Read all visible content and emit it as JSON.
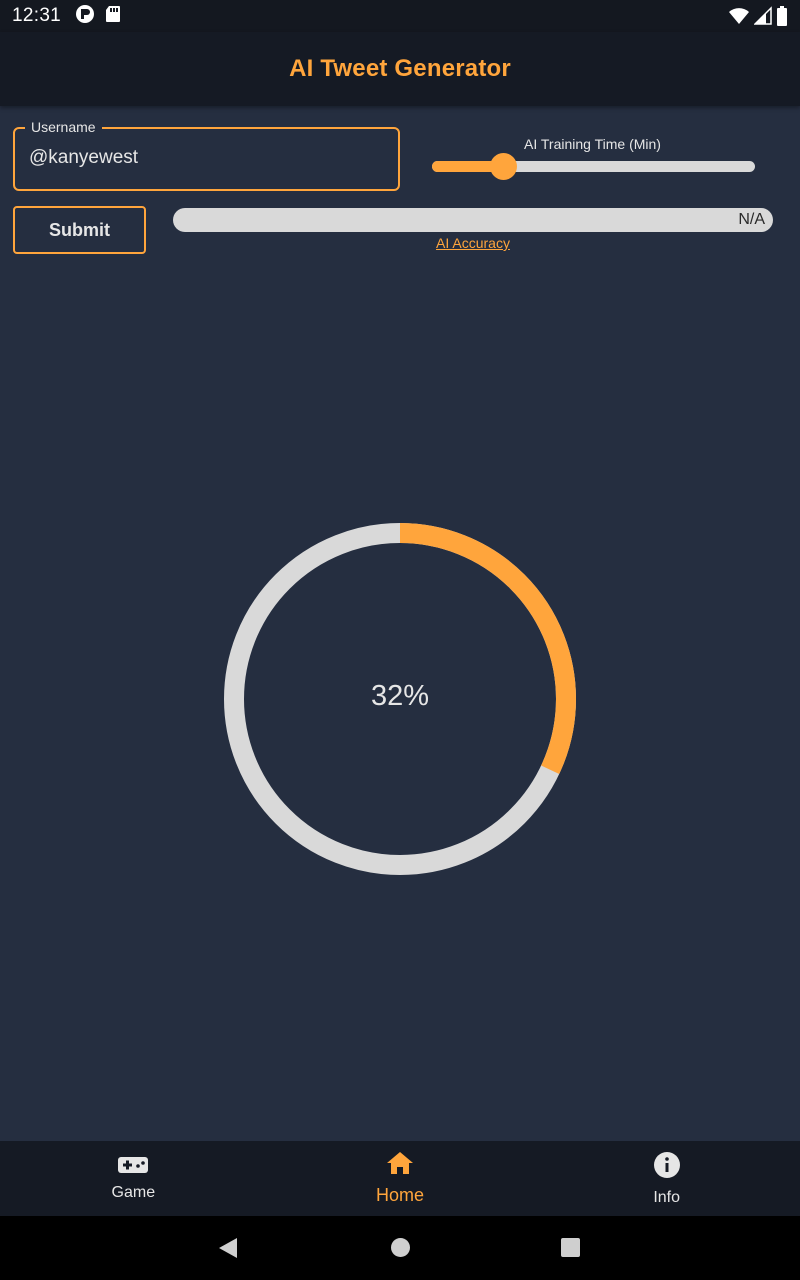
{
  "status_bar": {
    "time": "12:31",
    "left_icons": [
      "media-app-icon",
      "sd-card-icon"
    ],
    "right_icons": [
      "wifi-icon",
      "cell-signal-icon",
      "battery-icon"
    ]
  },
  "app_bar": {
    "title": "AI Tweet Generator"
  },
  "form": {
    "username_label": "Username",
    "username_value": "@kanyewest",
    "slider_label": "AI Training Time (Min)",
    "slider_fraction": 0.22,
    "submit_label": "Submit",
    "accuracy_value": "N/A",
    "accuracy_link": "AI Accuracy"
  },
  "progress": {
    "percent": 32,
    "label": "32%"
  },
  "bottom_nav": {
    "items": [
      {
        "label": "Game",
        "icon": "gamepad-icon",
        "active": false
      },
      {
        "label": "Home",
        "icon": "home-icon",
        "active": true
      },
      {
        "label": "Info",
        "icon": "info-icon",
        "active": false
      }
    ]
  },
  "colors": {
    "accent": "#ffa53c",
    "background": "#252e40",
    "bar": "#151a24",
    "track": "#d9d9d9",
    "text": "#e6e6e6"
  }
}
